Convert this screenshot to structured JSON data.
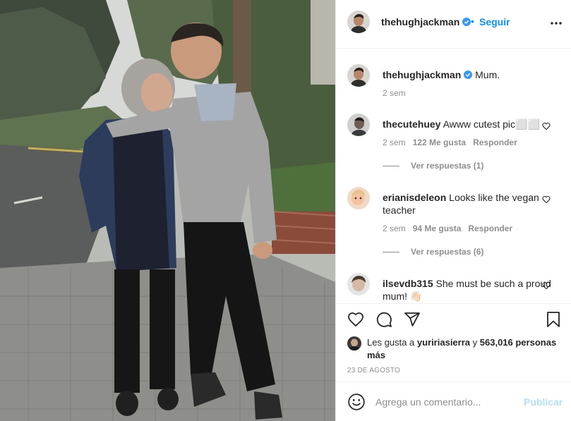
{
  "post": {
    "author": "thehughjackman",
    "follow_label": "Seguir",
    "separator": "•",
    "caption": {
      "username": "thehughjackman",
      "text": "Mum.",
      "time": "2 sem"
    }
  },
  "comments": [
    {
      "username": "thecutehuey",
      "text": "Awww cutest pic⬜⬜",
      "time": "2 sem",
      "likes": "122 Me gusta",
      "reply": "Responder",
      "view_replies": "Ver respuestas (1)"
    },
    {
      "username": "erianisdeleon",
      "text": "Looks like the vegan teacher",
      "time": "2 sem",
      "likes": "94 Me gusta",
      "reply": "Responder",
      "view_replies": "Ver respuestas (6)"
    },
    {
      "username": "ilsevdb315",
      "text": "She must be such a proud mum! 👋🏻"
    }
  ],
  "likes_summary": {
    "prefix": "Les gusta a",
    "user": "yuririasierra",
    "conjunction": "y",
    "count": "563,016 personas más"
  },
  "date": "23 DE AGOSTO",
  "add_comment": {
    "placeholder": "Agrega un comentario...",
    "publish_label": "Publicar"
  },
  "icons": {
    "more": "more-options-icon",
    "like": "heart-icon",
    "comment": "comment-icon",
    "share": "send-icon",
    "save": "bookmark-icon",
    "emoji": "emoji-icon",
    "verified": "verified-badge-icon"
  },
  "colors": {
    "accent": "#0095f6",
    "text": "#262626",
    "muted": "#8e8e8e",
    "border": "#efefef",
    "publish_disabled": "#b2dffc"
  }
}
